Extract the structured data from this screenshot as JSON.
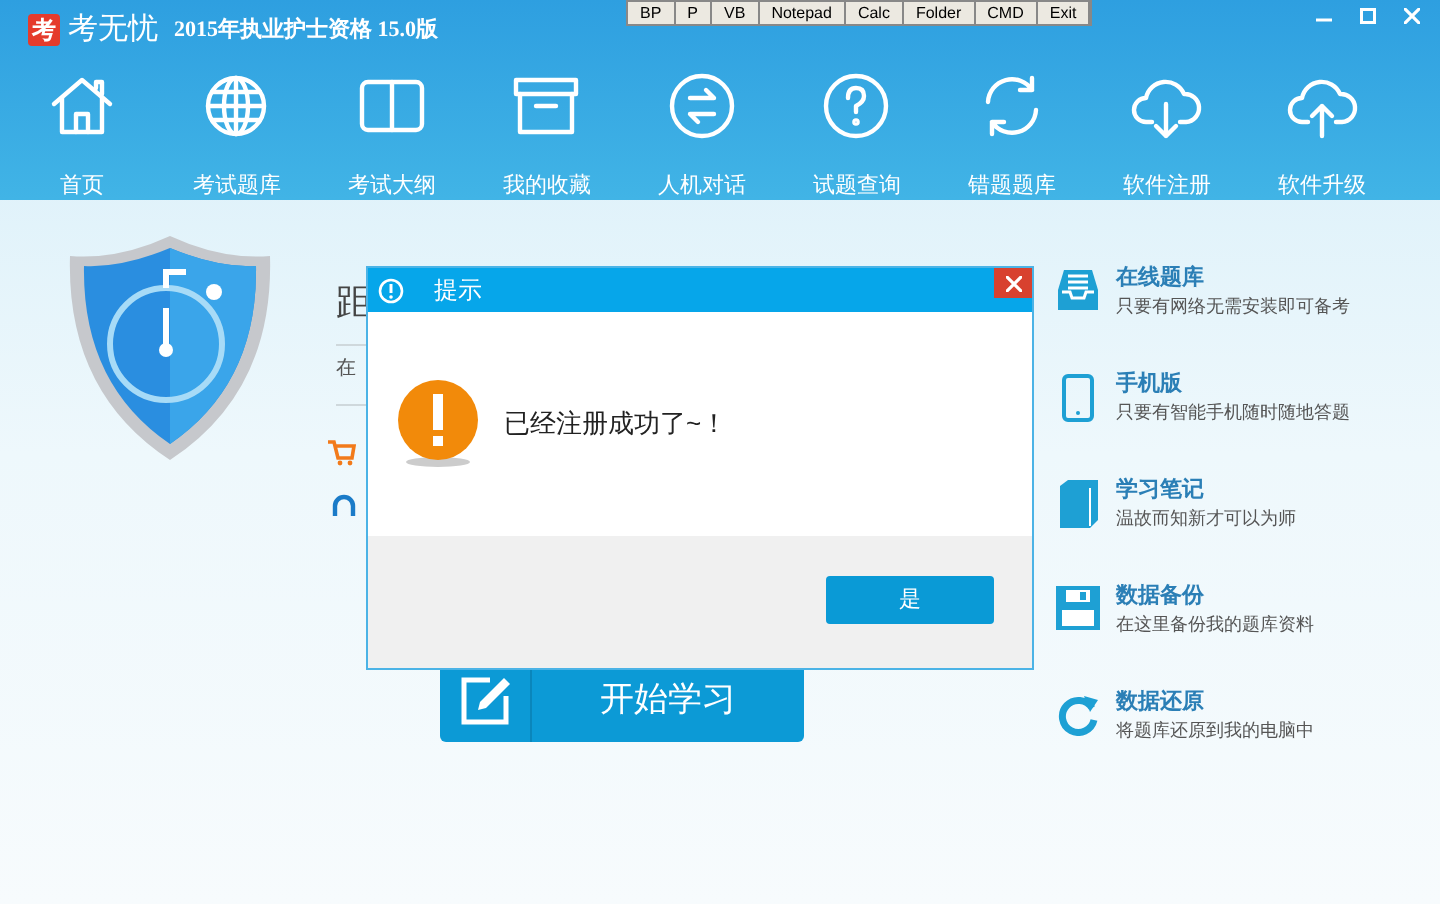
{
  "app": {
    "logo": "考",
    "name": "考无忧",
    "title": "2015年执业护士资格 15.0版"
  },
  "toolbar": [
    "BP",
    "P",
    "VB",
    "Notepad",
    "Calc",
    "Folder",
    "CMD",
    "Exit"
  ],
  "nav": [
    {
      "label": "首页"
    },
    {
      "label": "考试题库"
    },
    {
      "label": "考试大纲"
    },
    {
      "label": "我的收藏"
    },
    {
      "label": "人机对话"
    },
    {
      "label": "试题查询"
    },
    {
      "label": "错题题库"
    },
    {
      "label": "软件注册"
    },
    {
      "label": "软件升级"
    }
  ],
  "center": {
    "heading": "距",
    "subtitle": "在"
  },
  "start_button": "开始学习",
  "features": [
    {
      "title": "在线题库",
      "desc": "只要有网络无需安装即可备考"
    },
    {
      "title": "手机版",
      "desc": "只要有智能手机随时随地答题"
    },
    {
      "title": "学习笔记",
      "desc": "温故而知新才可以为师"
    },
    {
      "title": "数据备份",
      "desc": "在这里备份我的题库资料"
    },
    {
      "title": "数据还原",
      "desc": "将题库还原到我的电脑中"
    }
  ],
  "dialog": {
    "title": "提示",
    "message": "已经注册成功了~！",
    "button": "是"
  }
}
